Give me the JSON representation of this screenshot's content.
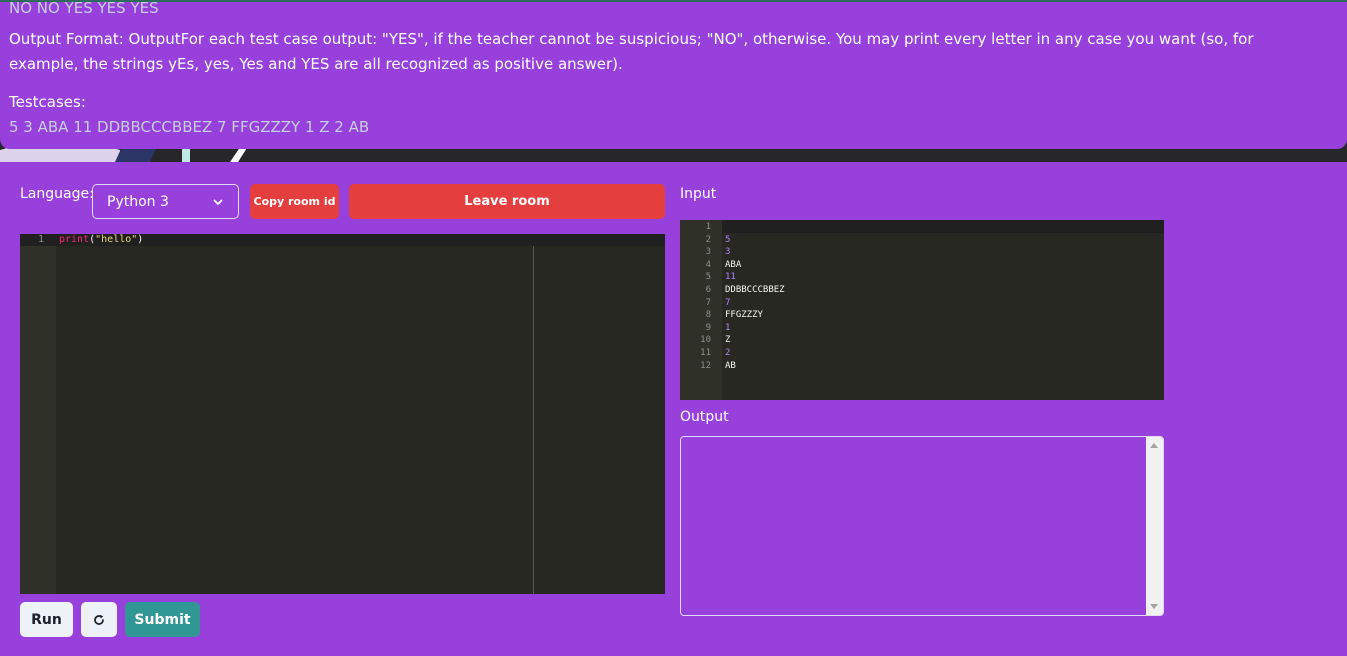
{
  "problem": {
    "sample_output": "NO NO YES YES YES",
    "output_format": "Output Format: OutputFor each test case output: \"YES\", if the teacher cannot be suspicious; \"NO\", otherwise. You may print every letter in any case you want (so, for example, the strings yEs, yes, Yes and YES are all recognized as positive answer).",
    "testcases_label": "Testcases:",
    "testcases_value": "5 3 ABA 11 DDBBCCCBBEZ 7 FFGZZZY 1 Z 2 AB"
  },
  "controls": {
    "language_label": "Language:",
    "language_selected": "Python 3",
    "copy_room_label": "Copy room id",
    "leave_room_label": "Leave room"
  },
  "editor": {
    "line_number": "1",
    "code_fn": "print",
    "code_paren_open": "(",
    "code_str": "\"hello\"",
    "code_paren_close": ")"
  },
  "input": {
    "label": "Input",
    "lines": [
      {
        "n": "1",
        "text": ""
      },
      {
        "n": "2",
        "text": "5"
      },
      {
        "n": "3",
        "text": "3"
      },
      {
        "n": "4",
        "text": "ABA"
      },
      {
        "n": "5",
        "text": "11"
      },
      {
        "n": "6",
        "text": "DDBBCCCBBEZ"
      },
      {
        "n": "7",
        "text": "7"
      },
      {
        "n": "8",
        "text": "FFGZZZY"
      },
      {
        "n": "9",
        "text": "1"
      },
      {
        "n": "10",
        "text": "Z"
      },
      {
        "n": "11",
        "text": "2"
      },
      {
        "n": "12",
        "text": "AB"
      }
    ]
  },
  "output": {
    "label": "Output",
    "value": ""
  },
  "actions": {
    "run_label": "Run",
    "reset_icon": "refresh-icon",
    "submit_label": "Submit"
  },
  "colors": {
    "background": "#9740dc",
    "danger": "#e53e3e",
    "submit": "#319795",
    "editor_bg": "#272822"
  }
}
